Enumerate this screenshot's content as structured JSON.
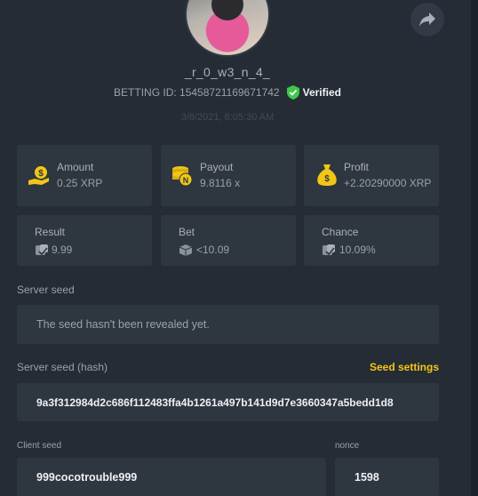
{
  "profile": {
    "username": "_r_0_w3_n_4_",
    "betting_id": "BETTING ID: 15458721169671742",
    "verified": "Verified",
    "timestamp": "3/8/2021, 8:05:30 AM"
  },
  "stats": {
    "amount": {
      "label": "Amount",
      "value": "0.25 XRP",
      "icon": "coin-hand-icon"
    },
    "payout": {
      "label": "Payout",
      "value": "9.8116 x",
      "icon": "coin-stack-icon"
    },
    "profit": {
      "label": "Profit",
      "value": "+2.20290000 XRP",
      "icon": "money-bag-icon"
    },
    "result": {
      "label": "Result",
      "value": "9.99",
      "icon": "dice-icon"
    },
    "bet": {
      "label": "Bet",
      "value": "<10.09",
      "icon": "cube-icon"
    },
    "chance": {
      "label": "Chance",
      "value": "10.09%",
      "icon": "dice-icon"
    }
  },
  "server_seed": {
    "label": "Server seed",
    "value": "The seed hasn't been revealed yet."
  },
  "server_seed_hash": {
    "label": "Server seed (hash)",
    "settings_link": "Seed settings",
    "value": "9a3f312984d2c686f112483ffa4b1261a497b141d9d7e3660347a5bedd1d8"
  },
  "client_seed": {
    "label": "Client seed",
    "value": "999cocotrouble999"
  },
  "nonce": {
    "label": "nonce",
    "value": "1598"
  },
  "colors": {
    "background": "#252c35",
    "card": "#2e3640",
    "accent": "#f2c617",
    "verified": "#3ec84a"
  }
}
